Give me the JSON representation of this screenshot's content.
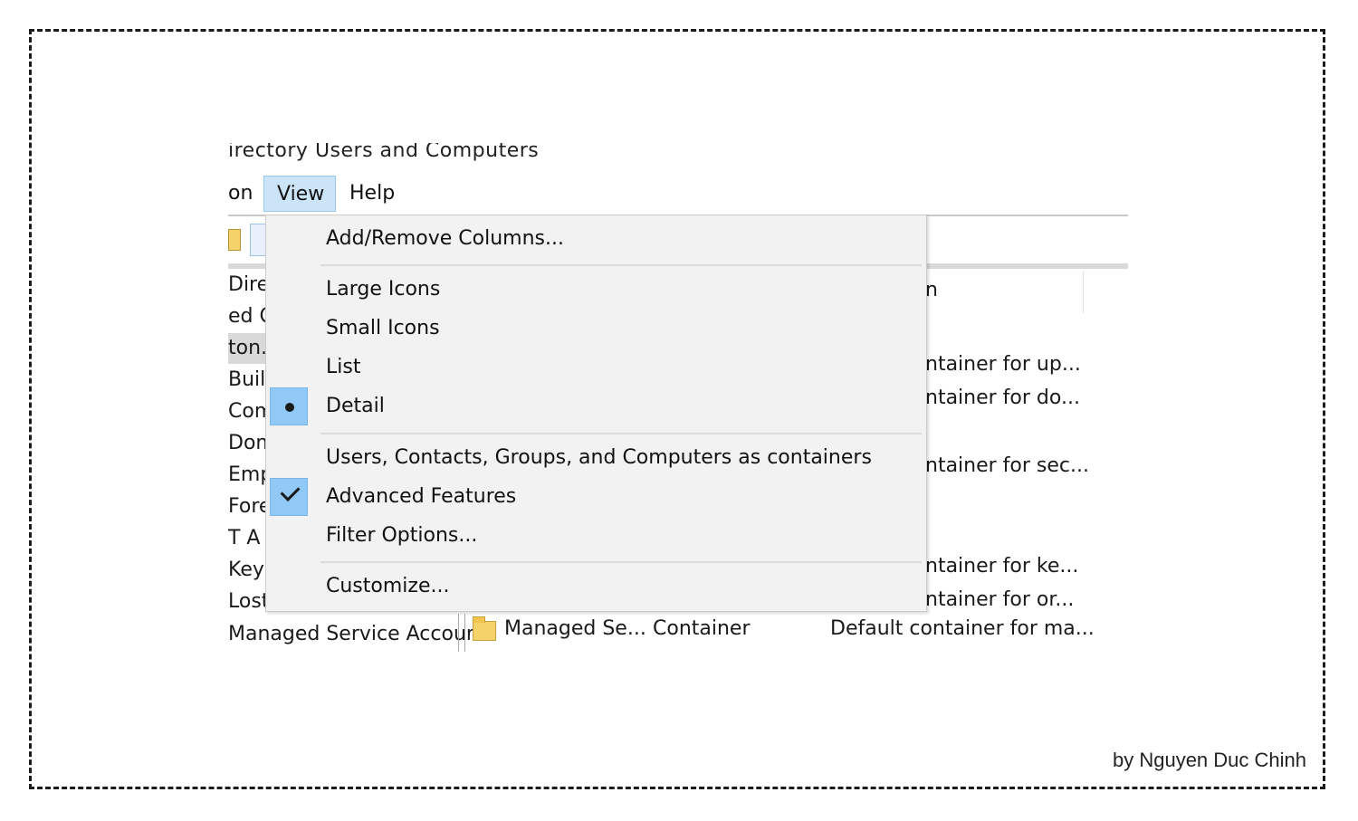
{
  "window": {
    "title_fragment": "irectory Users and Computers"
  },
  "menubar": {
    "items": [
      "on",
      "View",
      "Help"
    ],
    "active": "View"
  },
  "tree": {
    "rows": [
      "Direc",
      "ed Q",
      "ton.",
      "Built",
      "Com",
      "Dom",
      "Emp",
      "Fore",
      "T A",
      "Keys",
      "Lost",
      "Managed Service Accour"
    ]
  },
  "list": {
    "header_fragment": "n",
    "descriptions": [
      "ntainer for up...",
      "ntainer for do...",
      "ntainer for sec...",
      "ntainer for ke...",
      "ntainer for or..."
    ],
    "last_row": {
      "name": "Managed Se...",
      "type": "Container",
      "description": "Default container for ma..."
    }
  },
  "view_menu": {
    "items": [
      {
        "label": "Add/Remove Columns..."
      },
      {
        "label": "Large Icons"
      },
      {
        "label": "Small Icons"
      },
      {
        "label": "List"
      },
      {
        "label": "Detail",
        "mark": "bullet"
      },
      {
        "label": "Users, Contacts, Groups, and Computers as containers"
      },
      {
        "label": "Advanced Features",
        "mark": "check"
      },
      {
        "label": "Filter Options..."
      },
      {
        "label": "Customize..."
      }
    ]
  },
  "colors": {
    "highlight": "#90c8f6",
    "menu_bg": "#f2f2f2",
    "active_menu": "#cce4f7"
  },
  "credit": "by Nguyen Duc Chinh"
}
